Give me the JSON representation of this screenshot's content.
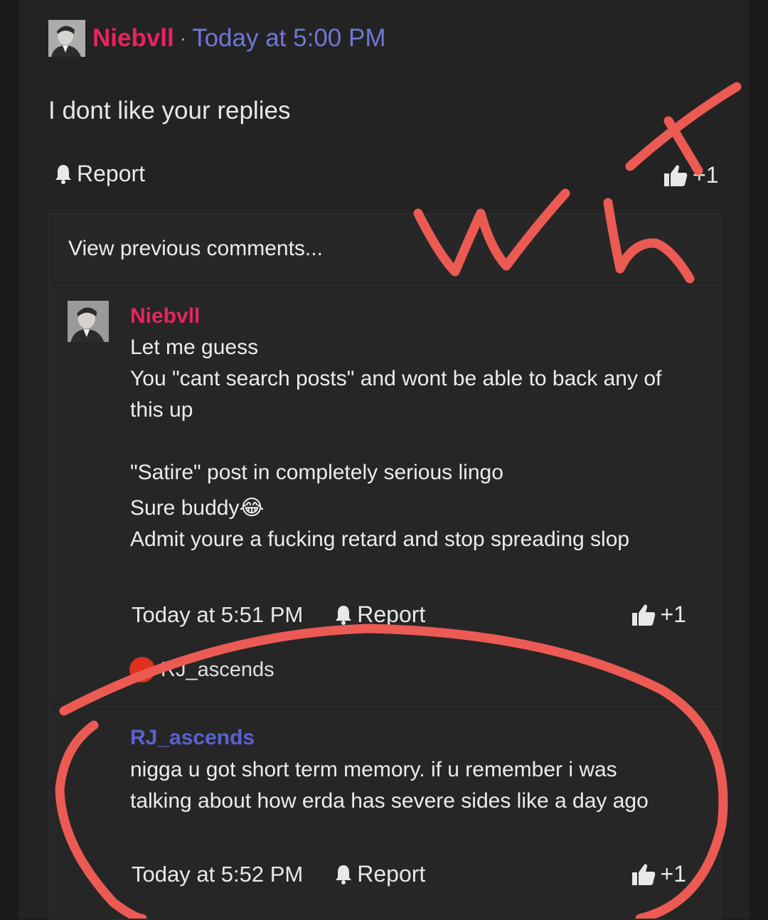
{
  "post": {
    "author": "Niebvll",
    "separator": "·",
    "time": "Today at 5:00 PM",
    "body": "I dont like your replies",
    "report_label": "Report",
    "like_count": "+1"
  },
  "comments": {
    "view_previous": "View previous comments...",
    "items": [
      {
        "author": "Niebvll",
        "author_color": "#e8245f",
        "lines": [
          "Let me guess",
          "You \"cant search posts\" and wont be able to back any of",
          "this up",
          "",
          "\"Satire\" post in completely serious lingo",
          "Sure buddy😂",
          "Admit youre a fucking retard and stop spreading slop"
        ],
        "time": "Today at 5:51 PM",
        "report_label": "Report",
        "like_count": "+1",
        "reaction_user": "RJ_ascends",
        "reaction_icon": "angry-face-icon"
      },
      {
        "author": "RJ_ascends",
        "author_color": "#5a62cf",
        "lines": [
          "nigga u got short term memory. if u remember i was",
          "talking about how erda has severe sides like a day ago"
        ],
        "time": "Today at 5:52 PM",
        "report_label": "Report",
        "like_count": "+1"
      }
    ]
  },
  "annotation": {
    "handwritten_text": "wtf",
    "color": "#ec5a54"
  }
}
